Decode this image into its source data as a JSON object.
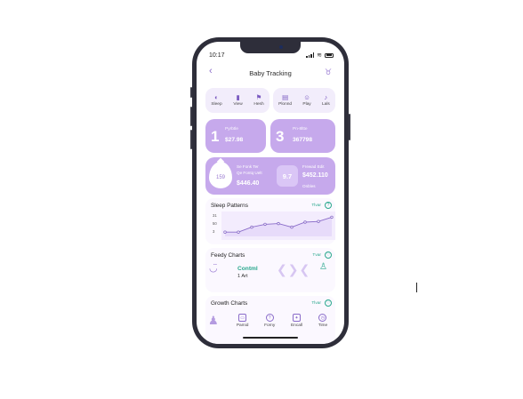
{
  "status_bar": {
    "time": "10:17",
    "signal_icon": "signal-icon",
    "wifi_icon": "wifi-icon",
    "battery_icon": "battery-icon"
  },
  "header": {
    "title": "Baby Tracking",
    "back_icon": "chevron-left-icon",
    "profile_icon": "baby-icon"
  },
  "quick_actions": [
    {
      "label": "Sleep",
      "icon": "moon-icon"
    },
    {
      "label": "View",
      "icon": "bar-chart-icon"
    },
    {
      "label": "Hesh",
      "icon": "flag-icon"
    },
    {
      "label": "Plonnd",
      "icon": "calendar-icon"
    },
    {
      "label": "Play",
      "icon": "smile-icon"
    },
    {
      "label": "Lals",
      "icon": "music-icon"
    }
  ],
  "summary_cards": [
    {
      "number": "1",
      "label": "Pyrbtle",
      "value": "$27.98"
    },
    {
      "number": "3",
      "label": "Pn-8ltte",
      "value": "367798"
    }
  ],
  "feature_card": {
    "badge": "159",
    "line1": "Se Fonk Ter",
    "line2": "Qe Fontq Uelt",
    "value": "$446.40",
    "percent": "9.7",
    "right_label": "Frewad Edit",
    "right_value": "$452.110",
    "right_sub": "Onbles"
  },
  "sleep_patterns": {
    "title": "Sleep Patterns",
    "link": "Tlvar",
    "icon": "info-icon",
    "y_ticks": [
      "31",
      "50",
      "3"
    ]
  },
  "feeding": {
    "title": "Feedy Charts",
    "link": "Tvar",
    "icon": "heart-icon",
    "line1": "Contml",
    "line2": "1 Art"
  },
  "growth": {
    "title": "Growth Charts",
    "link": "Tlvar",
    "icon": "heart-icon"
  },
  "tabs": [
    {
      "label": "Pamid",
      "icon": "tv-icon"
    },
    {
      "label": "Forny",
      "icon": "question-icon"
    },
    {
      "label": "Encall",
      "icon": "puzzle-icon"
    },
    {
      "label": "Time",
      "icon": "clock-icon"
    }
  ],
  "colors": {
    "accent": "#c6a9ec",
    "teal": "#2aa88e",
    "line": "#8a6cc9",
    "phone": "#2e2e3a"
  },
  "chart_data": {
    "type": "line",
    "x": [
      1,
      2,
      3,
      4,
      5,
      6,
      7,
      8,
      9
    ],
    "series": [
      {
        "values": [
          12,
          12,
          26,
          34,
          36,
          26,
          40,
          42,
          54
        ]
      }
    ],
    "title": "Sleep Patterns",
    "y_tick_labels": [
      "31",
      "50",
      "3"
    ]
  }
}
